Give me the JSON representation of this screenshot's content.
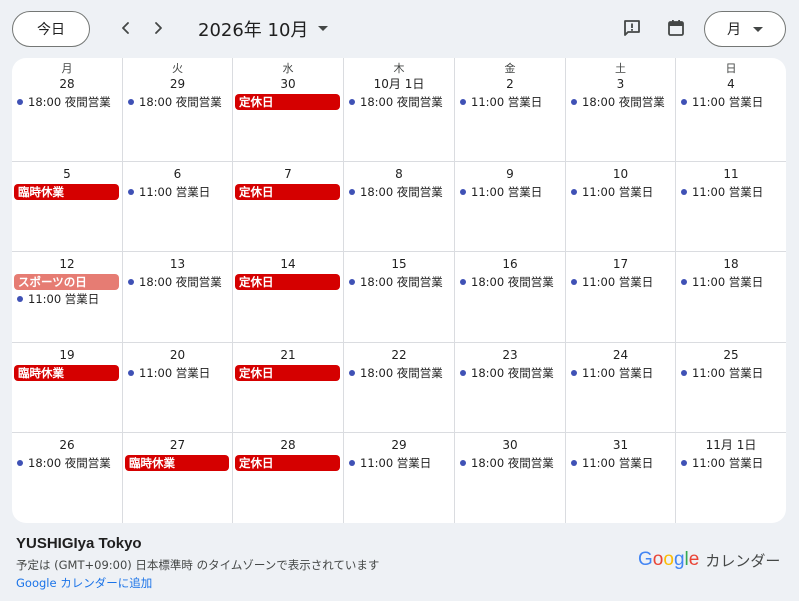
{
  "toolbar": {
    "today_label": "今日",
    "prev_glyph": "‹",
    "next_glyph": "›",
    "month_title": "2026年 10月",
    "view_label": "月"
  },
  "weekdays": [
    "月",
    "火",
    "水",
    "木",
    "金",
    "土",
    "日"
  ],
  "weeks": [
    [
      {
        "num": "28",
        "events": [
          {
            "kind": "dot",
            "text": "18:00 夜間営業"
          }
        ]
      },
      {
        "num": "29",
        "events": [
          {
            "kind": "dot",
            "text": "18:00 夜間営業"
          }
        ]
      },
      {
        "num": "30",
        "events": [
          {
            "kind": "pill",
            "color": "red",
            "text": "定休日"
          }
        ]
      },
      {
        "num": "10月 1日",
        "events": [
          {
            "kind": "dot",
            "text": "18:00 夜間営業"
          }
        ]
      },
      {
        "num": "2",
        "events": [
          {
            "kind": "dot",
            "text": "11:00 営業日"
          }
        ]
      },
      {
        "num": "3",
        "events": [
          {
            "kind": "dot",
            "text": "18:00 夜間営業"
          }
        ]
      },
      {
        "num": "4",
        "events": [
          {
            "kind": "dot",
            "text": "11:00 営業日"
          }
        ]
      }
    ],
    [
      {
        "num": "5",
        "events": [
          {
            "kind": "pill",
            "color": "red",
            "text": "臨時休業"
          }
        ]
      },
      {
        "num": "6",
        "events": [
          {
            "kind": "dot",
            "text": "11:00 営業日"
          }
        ]
      },
      {
        "num": "7",
        "events": [
          {
            "kind": "pill",
            "color": "red",
            "text": "定休日"
          }
        ]
      },
      {
        "num": "8",
        "events": [
          {
            "kind": "dot",
            "text": "18:00 夜間営業"
          }
        ]
      },
      {
        "num": "9",
        "events": [
          {
            "kind": "dot",
            "text": "11:00 営業日"
          }
        ]
      },
      {
        "num": "10",
        "events": [
          {
            "kind": "dot",
            "text": "11:00 営業日"
          }
        ]
      },
      {
        "num": "11",
        "events": [
          {
            "kind": "dot",
            "text": "11:00 営業日"
          }
        ]
      }
    ],
    [
      {
        "num": "12",
        "events": [
          {
            "kind": "pill",
            "color": "pink",
            "text": "スポーツの日"
          },
          {
            "kind": "dot",
            "text": "11:00 営業日"
          }
        ]
      },
      {
        "num": "13",
        "events": [
          {
            "kind": "dot",
            "text": "18:00 夜間営業"
          }
        ]
      },
      {
        "num": "14",
        "events": [
          {
            "kind": "pill",
            "color": "red",
            "text": "定休日"
          }
        ]
      },
      {
        "num": "15",
        "events": [
          {
            "kind": "dot",
            "text": "18:00 夜間営業"
          }
        ]
      },
      {
        "num": "16",
        "events": [
          {
            "kind": "dot",
            "text": "18:00 夜間営業"
          }
        ]
      },
      {
        "num": "17",
        "events": [
          {
            "kind": "dot",
            "text": "11:00 営業日"
          }
        ]
      },
      {
        "num": "18",
        "events": [
          {
            "kind": "dot",
            "text": "11:00 営業日"
          }
        ]
      }
    ],
    [
      {
        "num": "19",
        "events": [
          {
            "kind": "pill",
            "color": "red",
            "text": "臨時休業"
          }
        ]
      },
      {
        "num": "20",
        "events": [
          {
            "kind": "dot",
            "text": "11:00 営業日"
          }
        ]
      },
      {
        "num": "21",
        "events": [
          {
            "kind": "pill",
            "color": "red",
            "text": "定休日"
          }
        ]
      },
      {
        "num": "22",
        "events": [
          {
            "kind": "dot",
            "text": "18:00 夜間営業"
          }
        ]
      },
      {
        "num": "23",
        "events": [
          {
            "kind": "dot",
            "text": "18:00 夜間営業"
          }
        ]
      },
      {
        "num": "24",
        "events": [
          {
            "kind": "dot",
            "text": "11:00 営業日"
          }
        ]
      },
      {
        "num": "25",
        "events": [
          {
            "kind": "dot",
            "text": "11:00 営業日"
          }
        ]
      }
    ],
    [
      {
        "num": "26",
        "events": [
          {
            "kind": "dot",
            "text": "18:00 夜間営業"
          }
        ]
      },
      {
        "num": "27",
        "events": [
          {
            "kind": "pill",
            "color": "red",
            "text": "臨時休業"
          }
        ]
      },
      {
        "num": "28",
        "events": [
          {
            "kind": "pill",
            "color": "red",
            "text": "定休日"
          }
        ]
      },
      {
        "num": "29",
        "events": [
          {
            "kind": "dot",
            "text": "11:00 営業日"
          }
        ]
      },
      {
        "num": "30",
        "events": [
          {
            "kind": "dot",
            "text": "18:00 夜間営業"
          }
        ]
      },
      {
        "num": "31",
        "events": [
          {
            "kind": "dot",
            "text": "11:00 営業日"
          }
        ]
      },
      {
        "num": "11月 1日",
        "events": [
          {
            "kind": "dot",
            "text": "11:00 営業日"
          }
        ]
      }
    ]
  ],
  "colors": {
    "red": "#d50000",
    "pink": "#e67c73",
    "dot": "#3f51b5",
    "link": "#1a73e8"
  },
  "footer": {
    "calendar_name": "YUSHIGIya Tokyo",
    "timezone_note": "予定は (GMT+09:00) 日本標準時 のタイムゾーンで表示されています",
    "add_link": "Google カレンダーに追加",
    "brand_google": "Google",
    "brand_calendar": "カレンダー"
  },
  "icons": {
    "feedback": "feedback-icon",
    "calendar": "calendar-icon",
    "view_caret": "caret-down-icon"
  }
}
